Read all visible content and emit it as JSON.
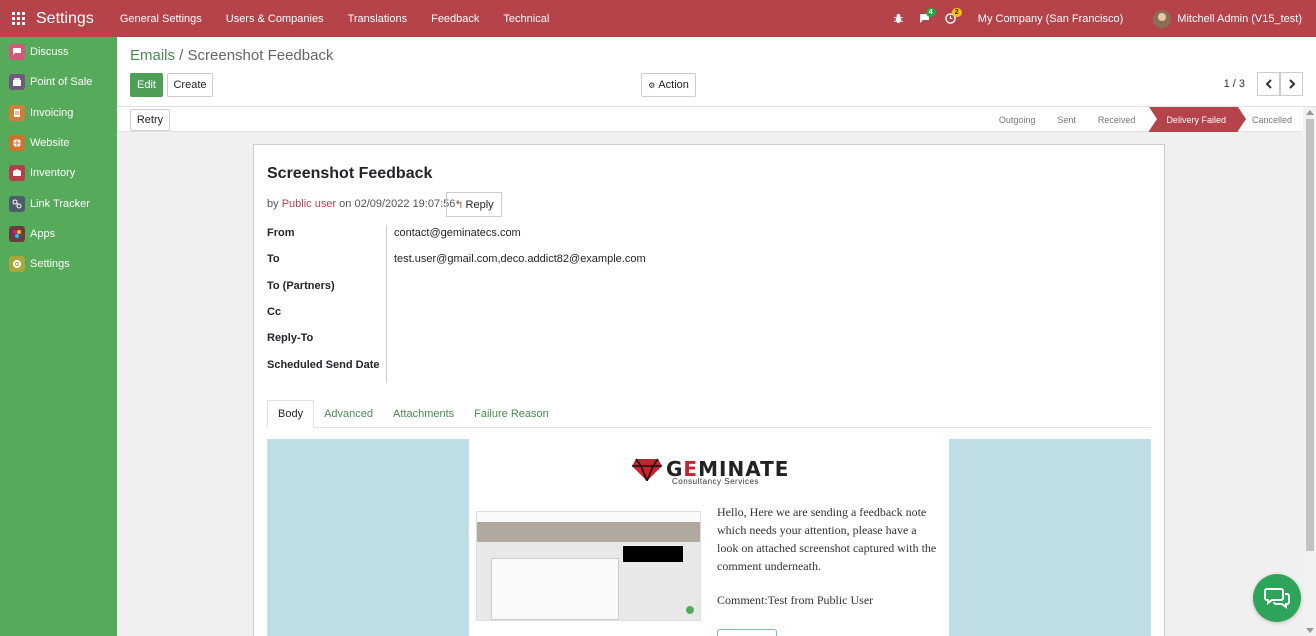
{
  "navbar": {
    "app_title": "Settings",
    "menu": [
      "General Settings",
      "Users & Companies",
      "Translations",
      "Feedback",
      "Technical"
    ],
    "messages_count": "4",
    "activities_count": "2",
    "company": "My Company (San Francisco)",
    "user": "Mitchell Admin (V15_test)"
  },
  "sidebar": {
    "items": [
      {
        "label": "Discuss",
        "icon": "discuss-icon",
        "color": "#d4587a"
      },
      {
        "label": "Point of Sale",
        "icon": "point-of-sale-icon",
        "color": "#6d5a7c"
      },
      {
        "label": "Invoicing",
        "icon": "invoicing-icon",
        "color": "#d57c3b"
      },
      {
        "label": "Website",
        "icon": "website-icon",
        "color": "#d0722f"
      },
      {
        "label": "Inventory",
        "icon": "inventory-icon",
        "color": "#b33f48"
      },
      {
        "label": "Link Tracker",
        "icon": "link-tracker-icon",
        "color": "#4c5c6b"
      },
      {
        "label": "Apps",
        "icon": "apps-icon",
        "color": "#6c3b40"
      },
      {
        "label": "Settings",
        "icon": "settings-icon",
        "color": "#a8a83a"
      }
    ]
  },
  "control": {
    "breadcrumb_parent": "Emails",
    "breadcrumb_sep": " / ",
    "breadcrumb_current": "Screenshot Feedback",
    "edit_label": "Edit",
    "create_label": "Create",
    "action_label": "Action",
    "pager": "1 / 3"
  },
  "statusbar": {
    "retry_label": "Retry",
    "stages": [
      "Outgoing",
      "Sent",
      "Received",
      "Delivery Failed",
      "Cancelled"
    ],
    "active_stage": "Delivery Failed"
  },
  "form": {
    "title": "Screenshot Feedback",
    "by": "by ",
    "author": "Public user",
    "date": " on 02/09/2022 19:07:56",
    "reply_label": "Reply",
    "fields": [
      {
        "label": "From",
        "value": "contact@geminatecs.com"
      },
      {
        "label": "To",
        "value": "test.user@gmail.com,deco.addict82@example.com"
      },
      {
        "label": "To (Partners)",
        "value": ""
      },
      {
        "label": "Cc",
        "value": ""
      },
      {
        "label": "Reply-To",
        "value": ""
      },
      {
        "label": "Scheduled Send Date",
        "value": ""
      }
    ],
    "tabs": [
      "Body",
      "Advanced",
      "Attachments",
      "Failure Reason"
    ],
    "active_tab": "Body"
  },
  "email_body": {
    "logo_text": "GEMINATE",
    "logo_subtitle": "Consultancy Services",
    "message": "Hello, Here we are sending a feedback note which needs your attention, please have a look on attached screenshot captured with the comment underneath.",
    "comment": "Comment:Test from Public User"
  },
  "colors": {
    "navbar": "#b6424a",
    "sidebar": "#56ab5a",
    "primary": "#4e9f56",
    "email_background": "#bfdde4"
  }
}
